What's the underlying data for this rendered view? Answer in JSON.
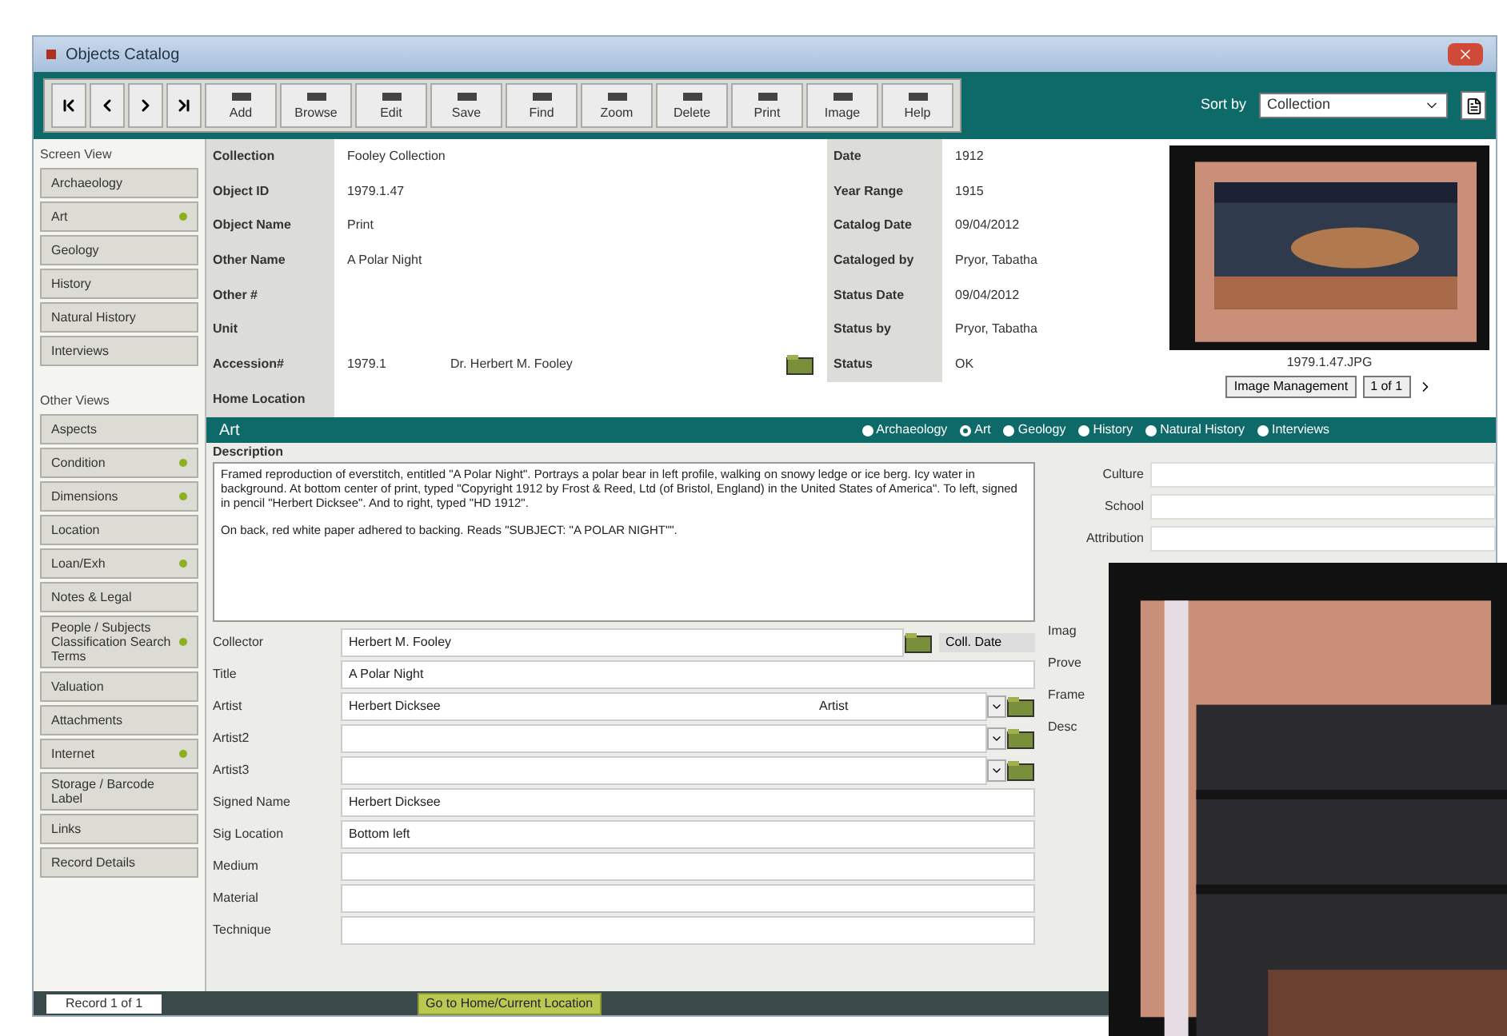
{
  "window": {
    "title": "Objects Catalog"
  },
  "toolbar": {
    "buttons": [
      "Add",
      "Browse",
      "Edit",
      "Save",
      "Find",
      "Zoom",
      "Delete",
      "Print",
      "Image",
      "Help"
    ],
    "sort": {
      "label": "Sort by",
      "value": "Collection"
    }
  },
  "sidebar": {
    "screen_view": {
      "title": "Screen View",
      "items": [
        {
          "label": "Archaeology",
          "flagged": false
        },
        {
          "label": "Art",
          "flagged": true
        },
        {
          "label": "Geology",
          "flagged": false
        },
        {
          "label": "History",
          "flagged": false
        },
        {
          "label": "Natural History",
          "flagged": false
        },
        {
          "label": "Interviews",
          "flagged": false
        }
      ]
    },
    "other_views": {
      "title": "Other Views",
      "items": [
        {
          "label": "Aspects",
          "flagged": false
        },
        {
          "label": "Condition",
          "flagged": true
        },
        {
          "label": "Dimensions",
          "flagged": true
        },
        {
          "label": "Location",
          "flagged": false
        },
        {
          "label": "Loan/Exh",
          "flagged": true
        },
        {
          "label": "Notes & Legal",
          "flagged": false
        },
        {
          "label": "People / Subjects Classification Search Terms",
          "flagged": true
        },
        {
          "label": "Valuation",
          "flagged": false
        },
        {
          "label": "Attachments",
          "flagged": false
        },
        {
          "label": "Internet",
          "flagged": true
        },
        {
          "label": "Storage / Barcode Label",
          "flagged": false
        },
        {
          "label": "Links",
          "flagged": false
        },
        {
          "label": "Record Details",
          "flagged": false
        }
      ]
    }
  },
  "record": {
    "left_fields": [
      {
        "label": "Collection",
        "value": "Fooley Collection"
      },
      {
        "label": "Object ID",
        "value": "1979.1.47"
      },
      {
        "label": "Object Name",
        "value": "Print"
      },
      {
        "label": "Other Name",
        "value": "A Polar Night"
      },
      {
        "label": "Other #"
      },
      {
        "label": "Unit"
      },
      {
        "label": "Accession#",
        "value": "1979.1",
        "extra": "Dr. Herbert M. Fooley"
      },
      {
        "label": "Home Location"
      }
    ],
    "right_fields": [
      {
        "label": "Date",
        "value": "1912"
      },
      {
        "label": "Year Range",
        "value": "1915"
      },
      {
        "label": "Catalog Date",
        "value": "09/04/2012"
      },
      {
        "label": "Cataloged by",
        "value": "Pryor, Tabatha"
      },
      {
        "label": "Status Date",
        "value": "09/04/2012"
      },
      {
        "label": "Status by",
        "value": "Pryor, Tabatha"
      },
      {
        "label": "Status",
        "value": "OK"
      }
    ],
    "image": {
      "caption": "1979.1.47.JPG",
      "manage_button": "Image Management",
      "counter": "1 of 1"
    }
  },
  "section": {
    "title": "Art",
    "types": [
      {
        "label": "Archaeology",
        "selected": false
      },
      {
        "label": "Art",
        "selected": true
      },
      {
        "label": "Geology",
        "selected": false
      },
      {
        "label": "History",
        "selected": false
      },
      {
        "label": "Natural History",
        "selected": false
      },
      {
        "label": "Interviews",
        "selected": false
      }
    ]
  },
  "description": {
    "label": "Description",
    "paragraphs": [
      "Framed reproduction of everstitch, entitled \"A Polar Night\". Portrays a polar bear in left profile, walking on snowy ledge or ice berg. Icy water in background. At bottom center of print, typed \"Copyright 1912 by Frost & Reed, Ltd (of Bristol, England) in the United States of America\". To left, signed in pencil \"Herbert Dicksee\". And to right, typed \"HD 1912\".",
      "On back, red white paper adhered to backing. Reads \"SUBJECT: \"A POLAR NIGHT\"\"."
    ]
  },
  "art_fields": [
    {
      "label": "Collector",
      "value": "Herbert M. Fooley",
      "kind": "lookup",
      "side": "Coll. Date"
    },
    {
      "label": "Title",
      "value": "A Polar Night",
      "kind": "text"
    },
    {
      "label": "Artist",
      "value": "Herbert Dicksee",
      "kind": "artist",
      "role": "Artist"
    },
    {
      "label": "Artist2",
      "kind": "artist"
    },
    {
      "label": "Artist3",
      "kind": "artist"
    },
    {
      "label": "Signed Name",
      "value": "Herbert Dicksee",
      "kind": "text"
    },
    {
      "label": "Sig Location",
      "value": "Bottom left",
      "kind": "text"
    },
    {
      "label": "Medium",
      "kind": "text"
    },
    {
      "label": "Material",
      "kind": "text"
    },
    {
      "label": "Technique",
      "kind": "text"
    }
  ],
  "right_panel": {
    "fields": [
      "Culture",
      "School",
      "Attribution"
    ],
    "cut_labels": [
      "Imag",
      "Prove",
      "Frame",
      "Desc"
    ]
  },
  "status_bar": {
    "record": "Record 1 of 1",
    "location_button": "Go to Home/Current Location"
  }
}
